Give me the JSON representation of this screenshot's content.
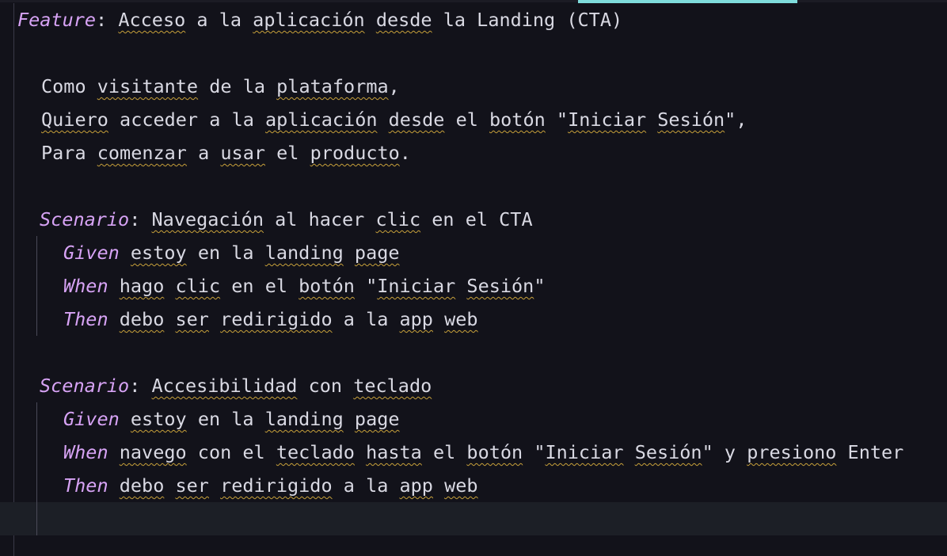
{
  "editor": {
    "feature": {
      "keyword": "Feature",
      "colon": ":",
      "title": "Acceso a la aplicación desde la Landing (CTA)"
    },
    "narrative": [
      "Como visitante de la plataforma,",
      "Quiero acceder a la aplicación desde el botón \"Iniciar Sesión\",",
      "Para comenzar a usar el producto."
    ],
    "scenarios": [
      {
        "keyword": "Scenario",
        "title": "Navegación al hacer clic en el CTA",
        "steps": [
          {
            "keyword": "Given",
            "text": "estoy en la landing page"
          },
          {
            "keyword": "When",
            "text": "hago clic en el botón \"Iniciar Sesión\""
          },
          {
            "keyword": "Then",
            "text": "debo ser redirigido a la app web"
          }
        ]
      },
      {
        "keyword": "Scenario",
        "title": "Accesibilidad con teclado",
        "steps": [
          {
            "keyword": "Given",
            "text": "estoy en la landing page"
          },
          {
            "keyword": "When",
            "text": "navego con el teclado hasta el botón \"Iniciar Sesión\" y presiono Enter"
          },
          {
            "keyword": "Then",
            "text": "debo ser redirigido a la app web"
          }
        ]
      }
    ],
    "colors": {
      "background": "#12121a",
      "keyword": "#d7a3f5",
      "text": "#d9d9e3",
      "squiggle": "#c8a13a",
      "active_tab": "#7fdcdc",
      "current_line": "#1c1f26"
    }
  }
}
